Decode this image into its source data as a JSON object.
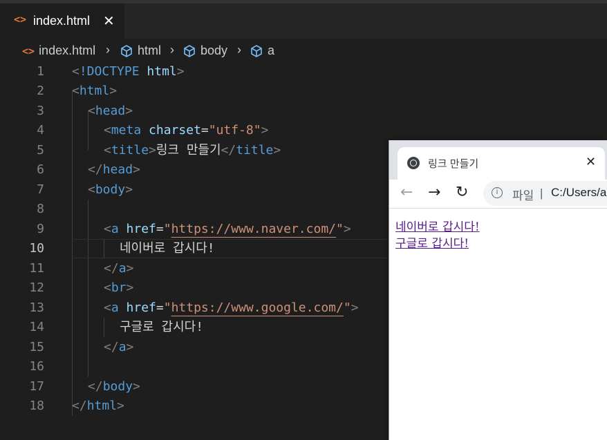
{
  "editor_tab": {
    "title": "index.html",
    "icon": "html-file-icon",
    "close": "✕"
  },
  "breadcrumb": {
    "file": "index.html",
    "items": [
      "html",
      "body",
      "a"
    ]
  },
  "code_lines": [
    {
      "n": "1"
    },
    {
      "n": "2"
    },
    {
      "n": "3"
    },
    {
      "n": "4"
    },
    {
      "n": "5"
    },
    {
      "n": "6"
    },
    {
      "n": "7"
    },
    {
      "n": "8"
    },
    {
      "n": "9"
    },
    {
      "n": "10"
    },
    {
      "n": "11"
    },
    {
      "n": "12"
    },
    {
      "n": "13"
    },
    {
      "n": "14"
    },
    {
      "n": "15"
    },
    {
      "n": "16"
    },
    {
      "n": "17"
    },
    {
      "n": "18"
    }
  ],
  "code": {
    "doctype": "!DOCTYPE",
    "doctype_val": "html",
    "html": "html",
    "head": "head",
    "meta": "meta",
    "charset": "charset",
    "charset_val": "\"utf-8\"",
    "title_tag": "title",
    "title_text": "링크 만들기",
    "body": "body",
    "a": "a",
    "href": "href",
    "url1_open": "\"",
    "url1": "https://www.naver.com/",
    "url1_close": "\"",
    "text1": "네이버로 갑시다!",
    "br": "br",
    "url2": "https://www.google.com/",
    "text2": "구글로 갑시다!"
  },
  "browser": {
    "tab_title": "링크 만들기",
    "tab_close": "✕",
    "scheme": "파일",
    "divider": "|",
    "url": "C:/Users/a",
    "links": [
      "네이버로 갑시다!",
      "구글로 갑시다!"
    ]
  },
  "colors": {
    "tag": "#569cd6",
    "attr": "#9cdcfe",
    "string": "#ce9178",
    "bracket": "#808080"
  }
}
